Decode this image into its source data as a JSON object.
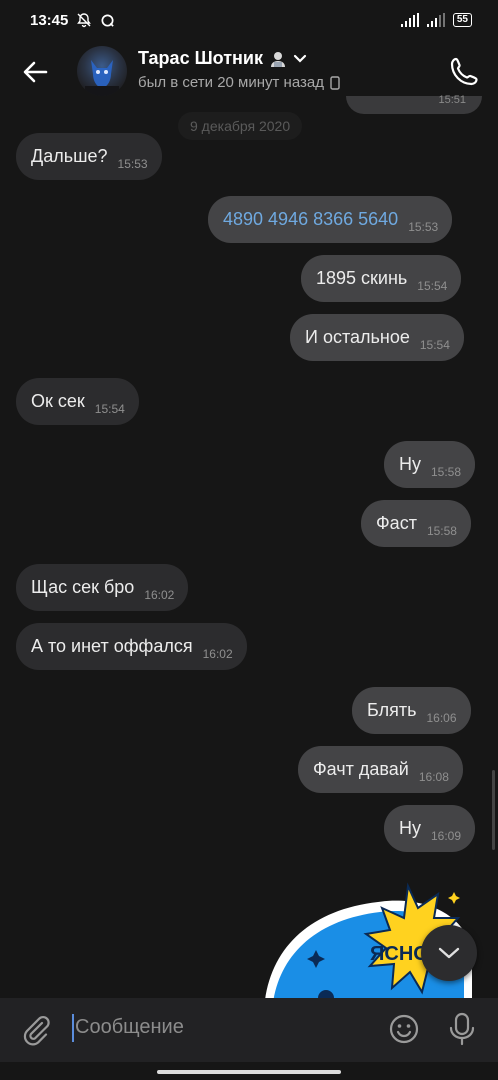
{
  "status_bar": {
    "time": "13:45",
    "battery": "55"
  },
  "header": {
    "contact_name": "Тарас Шотник",
    "presence": "был в сети 20 минут назад"
  },
  "date_separator": "9 декабря 2020",
  "peek_time": "15:51",
  "messages": [
    {
      "text": "Дальше?",
      "time": "15:53",
      "direction": "in"
    },
    {
      "text": "4890 4946 8366 5640",
      "time": "15:53",
      "direction": "out",
      "link": true
    },
    {
      "text": "1895 скинь",
      "time": "15:54",
      "direction": "out"
    },
    {
      "text": "И остальное",
      "time": "15:54",
      "direction": "out"
    },
    {
      "text": "Ок сек",
      "time": "15:54",
      "direction": "in"
    },
    {
      "text": "Ну",
      "time": "15:58",
      "direction": "out"
    },
    {
      "text": "Фаст",
      "time": "15:58",
      "direction": "out"
    },
    {
      "text": "Щас сек бро",
      "time": "16:02",
      "direction": "in"
    },
    {
      "text": "А то инет оффался",
      "time": "16:02",
      "direction": "in"
    },
    {
      "text": "Блять",
      "time": "16:06",
      "direction": "out"
    },
    {
      "text": "Фачт давай",
      "time": "16:08",
      "direction": "out"
    },
    {
      "text": "Ну",
      "time": "16:09",
      "direction": "out"
    }
  ],
  "sticker_text": "ЯСНО",
  "composer": {
    "placeholder": "Сообщение"
  },
  "colors": {
    "background": "#161616",
    "bubble_in": "#2c2c2e",
    "bubble_out": "#444446",
    "link": "#6fa9e0",
    "accent": "#5b8ddc"
  }
}
